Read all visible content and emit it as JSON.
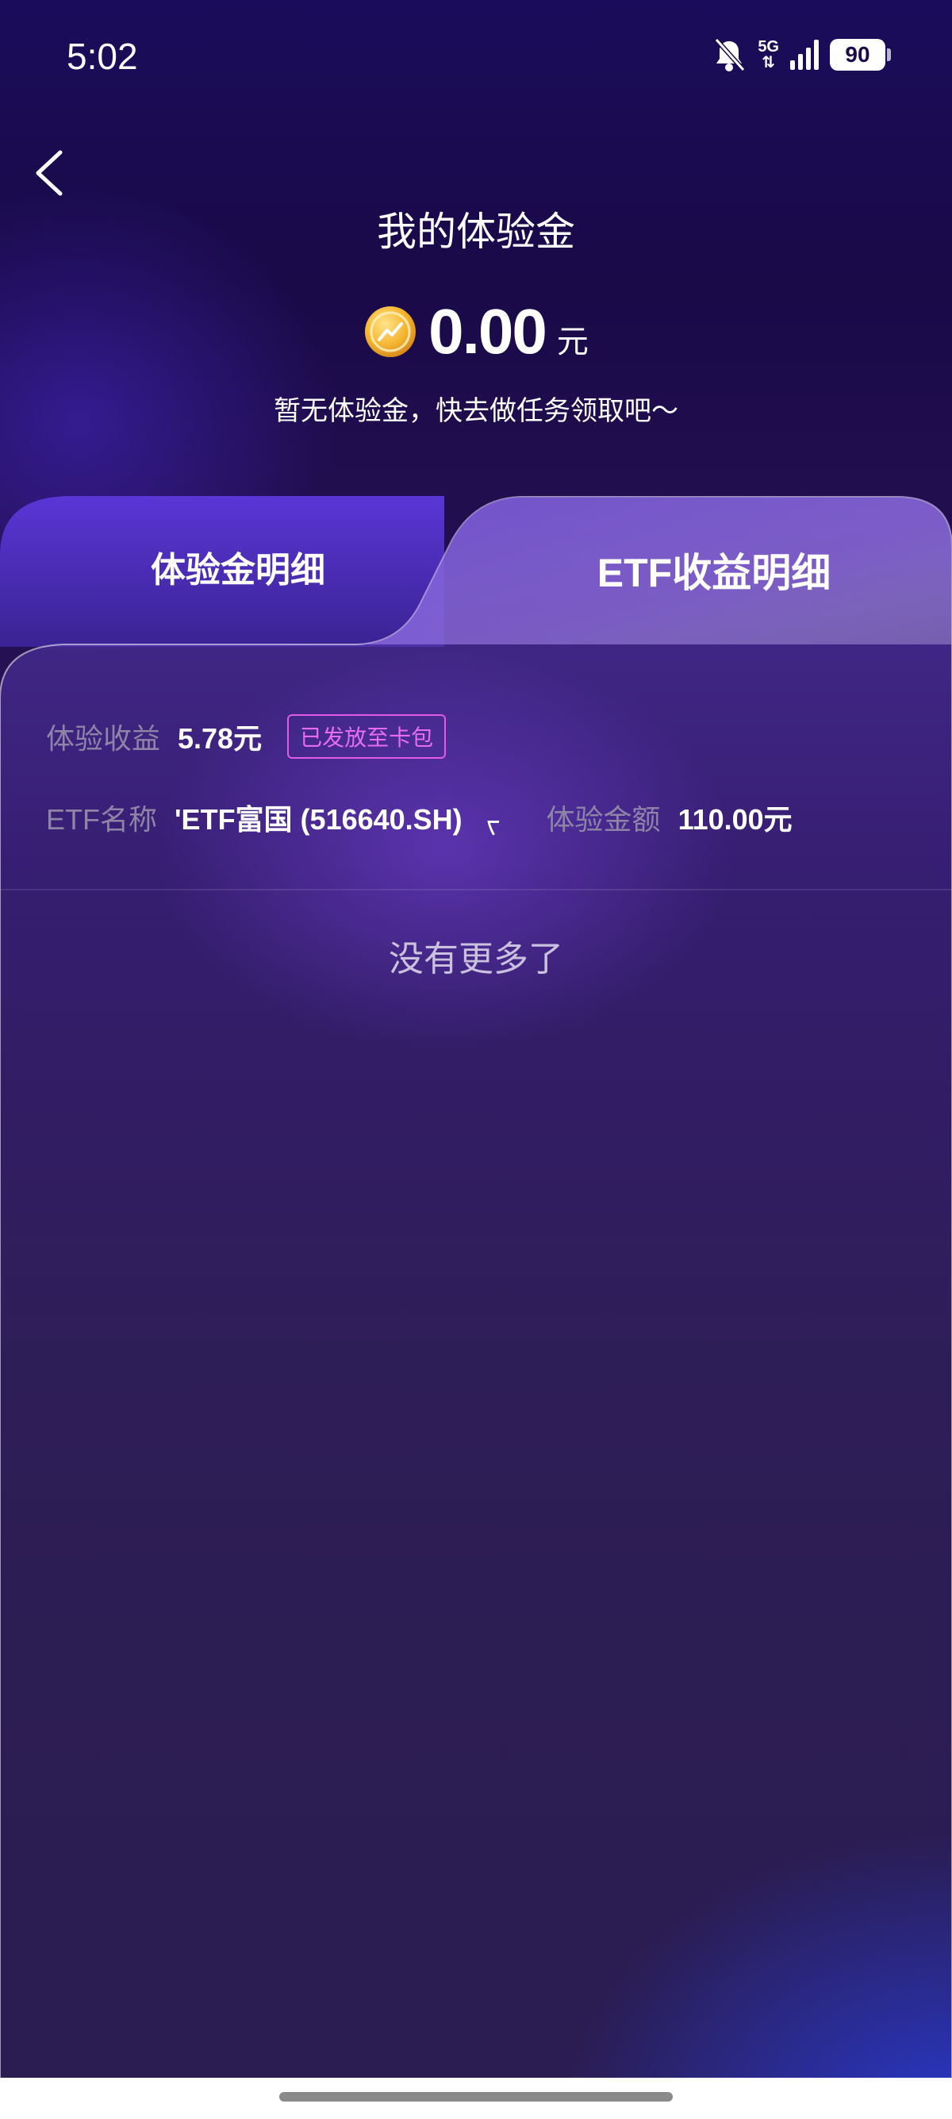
{
  "status": {
    "time": "5:02",
    "network": "5G",
    "battery": "90"
  },
  "header": {
    "title": "我的体验金",
    "amount": "0.00",
    "unit": "元",
    "subtitle": "暂无体验金，快去做任务领取吧～"
  },
  "tabs": [
    {
      "label": "体验金明细",
      "active": false
    },
    {
      "label": "ETF收益明细",
      "active": true
    }
  ],
  "record": {
    "profit_label": "体验收益",
    "profit_value": "5.78元",
    "badge": "已发放至卡包",
    "etf_label": "ETF名称",
    "etf_value": "'ETF富国 (516640.SH)",
    "etf_clipped": "ᡕ",
    "amount_label": "体验金额",
    "amount_value": "110.00元"
  },
  "list_end_text": "没有更多了",
  "colors": {
    "accent_badge": "#e05be8",
    "bg_top": "#1a0c5a",
    "tab_active": "#6a45c9"
  }
}
